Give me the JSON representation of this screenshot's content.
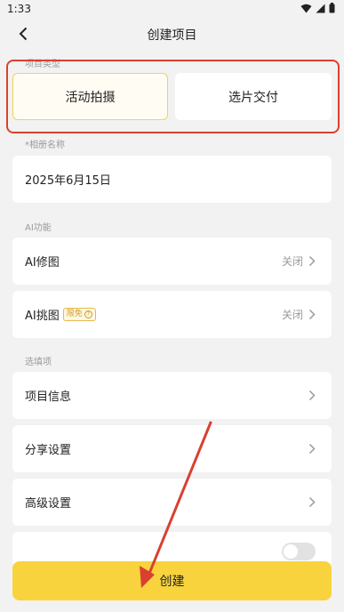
{
  "status_bar": {
    "time": "1:33"
  },
  "header": {
    "title": "创建项目"
  },
  "project_type": {
    "label": "项目类型",
    "options": [
      {
        "label": "活动拍摄",
        "selected": true
      },
      {
        "label": "选片交付",
        "selected": false
      }
    ]
  },
  "album": {
    "label": "*相册名称",
    "value": "2025年6月15日"
  },
  "ai": {
    "label": "AI功能",
    "items": [
      {
        "label": "AI修图",
        "status": "关闭"
      },
      {
        "label": "AI挑图",
        "badge": "限免",
        "status": "关闭"
      }
    ]
  },
  "options": {
    "label": "选填项",
    "items": [
      {
        "label": "项目信息"
      },
      {
        "label": "分享设置"
      },
      {
        "label": "高级设置"
      }
    ]
  },
  "create_button": {
    "label": "创建"
  },
  "colors": {
    "accent": "#f8d33e",
    "annotation": "#d9412f"
  }
}
